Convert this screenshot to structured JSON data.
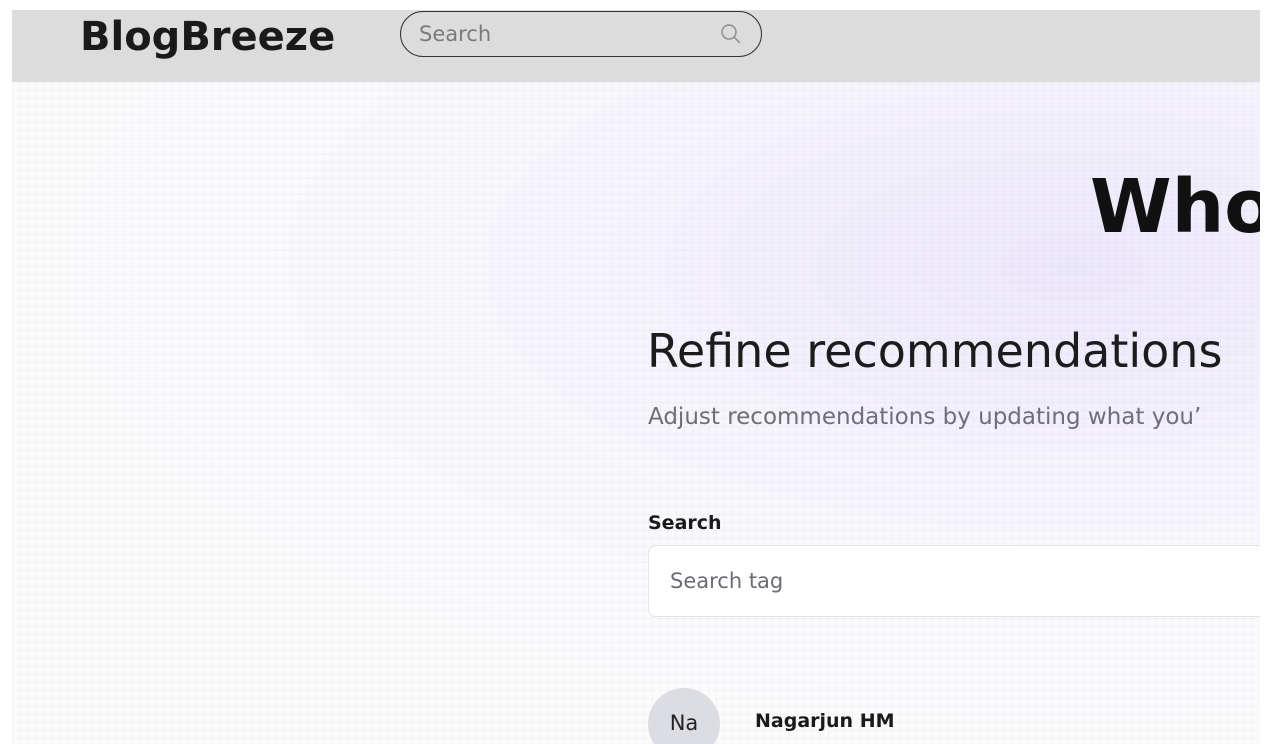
{
  "header": {
    "brand": "BlogBreeze",
    "search": {
      "placeholder": "Search",
      "value": "",
      "icon": "search-icon"
    }
  },
  "main": {
    "hero_title": "Who",
    "refine": {
      "title": "Refine recommendations",
      "subtitle": "Adjust recommendations by updating what you’"
    },
    "tag_search": {
      "label": "Search",
      "placeholder": "Search tag",
      "value": ""
    },
    "users": [
      {
        "avatar_initials": "Na",
        "name": "Nagarjun HM"
      }
    ]
  },
  "colors": {
    "header_background": "#dcdcdc",
    "page_background": "#fbfbfc",
    "avatar_background": "#dcdde2",
    "subtitle_text": "#6e6e78",
    "accent_tint": "#e0d7fa"
  }
}
